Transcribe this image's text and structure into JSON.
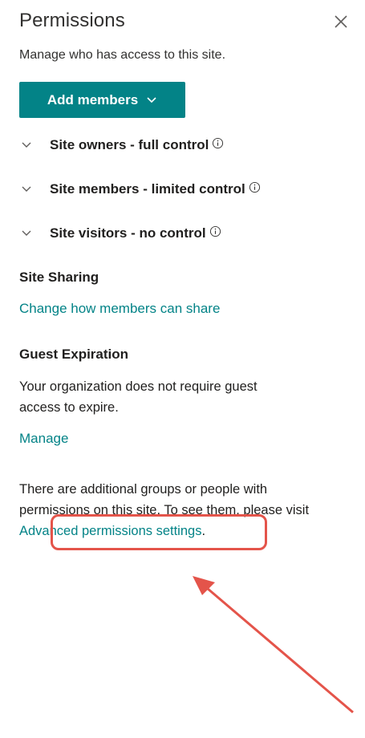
{
  "panel": {
    "title": "Permissions",
    "subtitle": "Manage who has access to this site.",
    "close_icon": "close-icon"
  },
  "add_members": {
    "label": "Add members",
    "icon": "chevron-down-icon"
  },
  "groups": [
    {
      "label": "Site owners - full control",
      "icon": "info-icon"
    },
    {
      "label": "Site members - limited control",
      "icon": "info-icon"
    },
    {
      "label": "Site visitors - no control",
      "icon": "info-icon"
    }
  ],
  "site_sharing": {
    "title": "Site Sharing",
    "link": "Change how members can share"
  },
  "guest_expiration": {
    "title": "Guest Expiration",
    "text": "Your organization does not require guest access to expire.",
    "link": "Manage"
  },
  "additional": {
    "text_before": "There are additional groups or people with permissions on this site. To see them, please visit ",
    "link": "Advanced permissions settings",
    "text_after": "."
  },
  "colors": {
    "accent": "#038387",
    "annotation": "#e4544a"
  }
}
